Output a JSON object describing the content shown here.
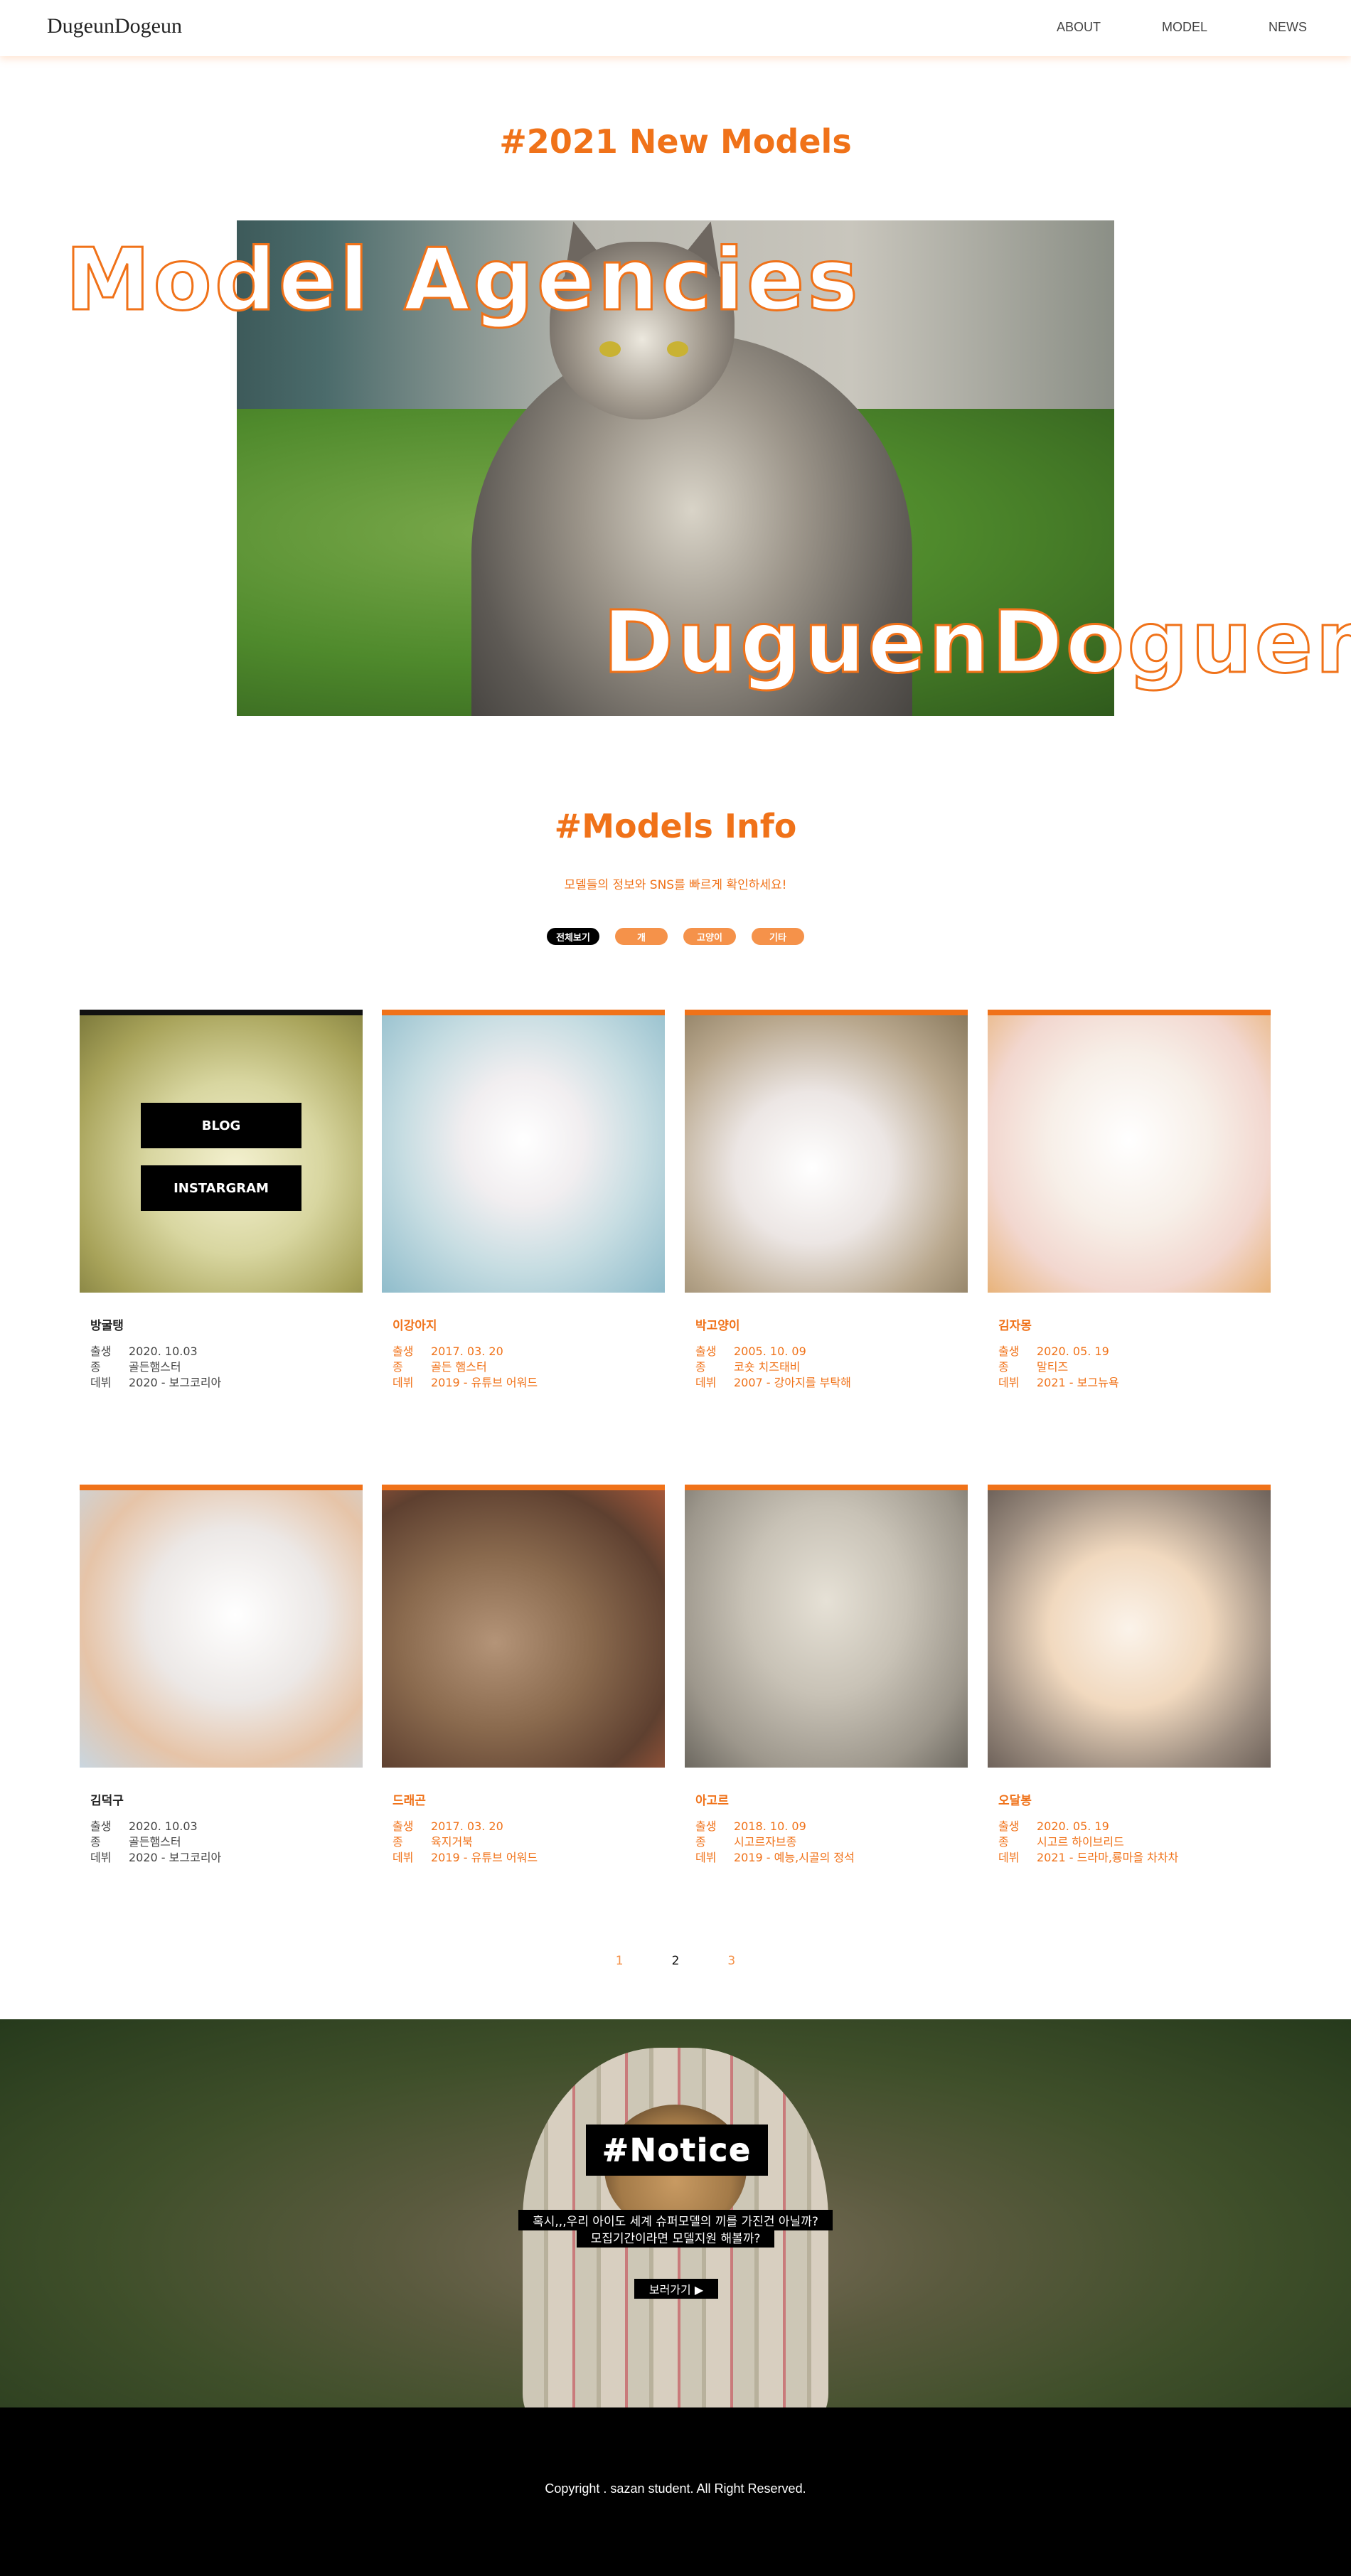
{
  "header": {
    "logo": "DugeunDogeun",
    "nav": [
      "ABOUT",
      "MODEL",
      "NEWS"
    ]
  },
  "hero": {
    "title": "#2021 New Models",
    "overlay_top": "Model Agencies",
    "overlay_bottom": "DuguenDoguen"
  },
  "models": {
    "title": "#Models Info",
    "subtitle": "모델들의 정보와 SNS를 빠르게 확인하세요!",
    "filters": [
      "전체보기",
      "개",
      "고양이",
      "기타"
    ],
    "overlay_buttons": [
      "BLOG",
      "INSTARGRAM"
    ],
    "labels": {
      "birth": "출생",
      "species": "종",
      "debut": "데뷔"
    },
    "cards": [
      {
        "name": "방굴탱",
        "birth": "2020. 10.03",
        "species": "골든햄스터",
        "debut": "2020 - 보그코리아"
      },
      {
        "name": "이강아지",
        "birth": "2017. 03. 20",
        "species": "골든 햄스터",
        "debut": "2019 - 유튜브 어워드"
      },
      {
        "name": "박고양이",
        "birth": "2005. 10. 09",
        "species": "코숏 치즈태비",
        "debut": "2007 - 강아지를 부탁해"
      },
      {
        "name": "김자몽",
        "birth": "2020. 05. 19",
        "species": "말티즈",
        "debut": "2021 - 보그뉴욕"
      },
      {
        "name": "김덕구",
        "birth": "2020. 10.03",
        "species": "골든햄스터",
        "debut": "2020 - 보그코리아"
      },
      {
        "name": "드래곤",
        "birth": "2017. 03. 20",
        "species": "육지거북",
        "debut": "2019 - 유튜브 어워드"
      },
      {
        "name": "아고르",
        "birth": "2018. 10. 09",
        "species": "시고르자브종",
        "debut": "2019 - 예능,시골의 정석"
      },
      {
        "name": "오달봉",
        "birth": "2020. 05. 19",
        "species": "시고르 하이브리드",
        "debut": "2021 - 드라마,룡마을 차차차"
      }
    ],
    "pagination": [
      "1",
      "2",
      "3"
    ],
    "current_page": "2"
  },
  "notice": {
    "title": "#Notice",
    "line1": "혹시,,,우리 아이도 세계 슈퍼모델의 끼를 가진건 아닐까?",
    "line2": "모집기간이라면 모델지원 해볼까?",
    "button": "보러가기 ▶"
  },
  "footer": {
    "copyright": "Copyright . sazan student. All Right Reserved."
  }
}
